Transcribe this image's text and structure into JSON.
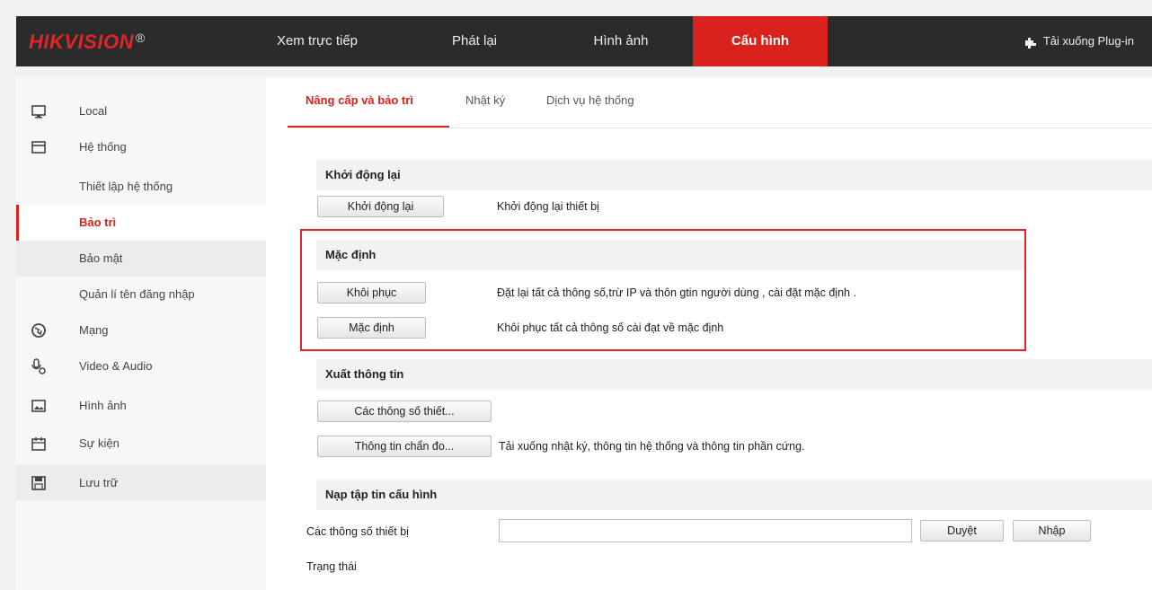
{
  "header": {
    "logo": "HIKVISION",
    "logo_mark": "®",
    "nav": [
      "Xem trực tiếp",
      "Phát lại",
      "Hình ảnh",
      "Cấu hình"
    ],
    "active_nav": "Cấu hình",
    "plugin_label": "Tải xuống Plug-in",
    "accent_color": "#d9211d"
  },
  "sidebar": {
    "items": [
      {
        "label": "Local",
        "icon": "monitor-icon"
      },
      {
        "label": "Hệ thống",
        "icon": "system-icon"
      },
      {
        "label": "Thiết lập hệ thống"
      },
      {
        "label": "Bảo trì"
      },
      {
        "label": "Bảo mật"
      },
      {
        "label": "Quản lí tên đăng nhập"
      },
      {
        "label": "Mạng",
        "icon": "globe-icon"
      },
      {
        "label": "Video & Audio",
        "icon": "microphone-icon"
      },
      {
        "label": "Hình ảnh",
        "icon": "image-icon"
      },
      {
        "label": "Sự kiện",
        "icon": "calendar-icon"
      },
      {
        "label": "Lưu trữ",
        "icon": "save-icon"
      }
    ]
  },
  "tabs": [
    "Nâng cấp và bảo trì",
    "Nhật ký",
    "Dịch vụ hệ thống"
  ],
  "sections": {
    "reboot": {
      "title": "Khởi động lại",
      "button": "Khởi động lại",
      "desc": "Khởi động lại thiết bị"
    },
    "default": {
      "title": "Mặc định",
      "restore_button": "Khôi phục",
      "restore_desc": "Đặt lại tất cả thông số,trừ IP và thôn gtin người dùng , cài đặt mặc định .",
      "default_button": "Mặc định",
      "default_desc": "Khôi phục tất cả thông số cài đạt về mặc định"
    },
    "export": {
      "title": "Xuất thông tin",
      "params_button": "Các thông số thiết...",
      "diag_button": "Thông tin chẩn đo...",
      "diag_desc": "Tải xuống nhật ký, thông tin hệ thống và thông tin phần cứng."
    },
    "import": {
      "title": "Nạp tập tin cấu hình",
      "label": "Các thông số thiết bị",
      "file_value": "",
      "browse_button": "Duyệt",
      "import_button": "Nhập",
      "status_label": "Trạng thái"
    }
  }
}
